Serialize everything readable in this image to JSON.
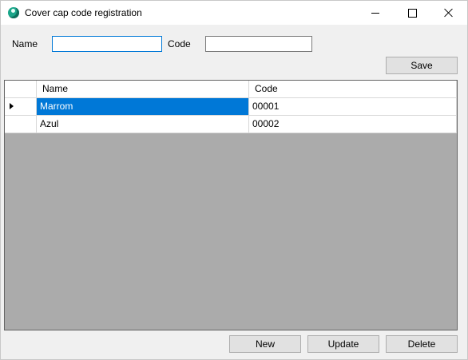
{
  "window": {
    "title": "Cover cap code registration"
  },
  "form": {
    "name_label": "Name",
    "name_value": "",
    "code_label": "Code",
    "code_value": "",
    "save_label": "Save"
  },
  "grid": {
    "columns": [
      "Name",
      "Code"
    ],
    "rows": [
      {
        "name": "Marrom",
        "code": "00001",
        "selected": true
      },
      {
        "name": "Azul",
        "code": "00002",
        "selected": false
      }
    ]
  },
  "actions": {
    "new_label": "New",
    "update_label": "Update",
    "delete_label": "Delete"
  },
  "colors": {
    "accent": "#0078d7",
    "grid_background": "#ababab"
  },
  "icons": [
    "app-icon",
    "minimize-icon",
    "maximize-icon",
    "close-icon",
    "row-indicator-icon"
  ]
}
